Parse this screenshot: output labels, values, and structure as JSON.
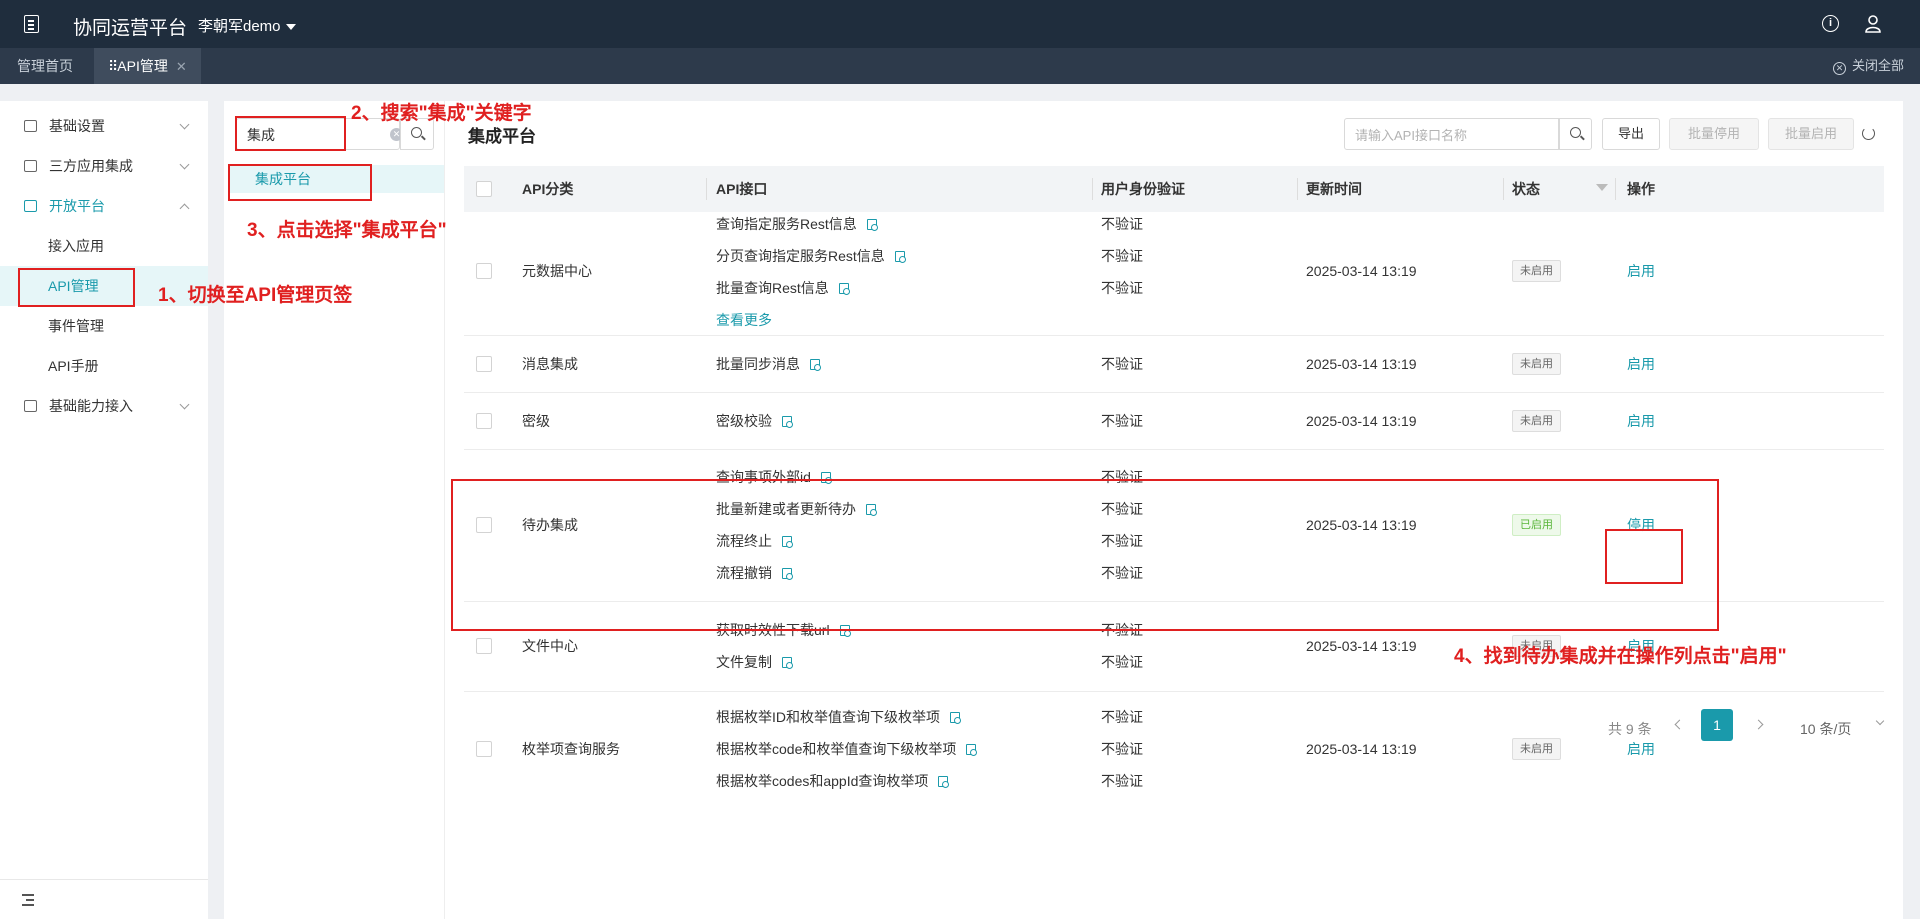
{
  "topbar": {
    "app_title": "协同运营平台",
    "user_name": "李朝军demo"
  },
  "tabs": [
    {
      "label": "管理首页"
    },
    {
      "label": "API管理"
    }
  ],
  "close_all": "关闭全部",
  "sidebar": {
    "groups": [
      {
        "label": "基础设置",
        "icon": "settings-icon"
      },
      {
        "label": "三方应用集成",
        "icon": "apps-icon"
      },
      {
        "label": "开放平台",
        "icon": "monitor-icon"
      },
      {
        "label": "基础能力接入",
        "icon": "capability-icon"
      }
    ],
    "items": [
      {
        "label": "接入应用"
      },
      {
        "label": "API管理"
      },
      {
        "label": "事件管理"
      },
      {
        "label": "API手册"
      }
    ]
  },
  "category_panel": {
    "search_value": "集成",
    "selected_item": "集成平台"
  },
  "main": {
    "title": "集成平台",
    "search_placeholder": "请输入API接口名称",
    "export_label": "导出",
    "batch_disable_label": "批量停用",
    "batch_enable_label": "批量启用",
    "columns": [
      "API分类",
      "API接口",
      "用户身份验证",
      "更新时间",
      "状态",
      "操作"
    ],
    "see_more": "查看更多",
    "rows": [
      {
        "category": "元数据中心",
        "apis": [
          "查询指定服务Rest信息",
          "分页查询指定服务Rest信息",
          "批量查询Rest信息"
        ],
        "auth": [
          "不验证",
          "不验证",
          "不验证"
        ],
        "time": "2025-03-14 13:19",
        "status": "未启用",
        "action": "启用"
      },
      {
        "category": "消息集成",
        "apis": [
          "批量同步消息"
        ],
        "auth": [
          "不验证"
        ],
        "time": "2025-03-14 13:19",
        "status": "未启用",
        "action": "启用"
      },
      {
        "category": "密级",
        "apis": [
          "密级校验"
        ],
        "auth": [
          "不验证"
        ],
        "time": "2025-03-14 13:19",
        "status": "未启用",
        "action": "启用"
      },
      {
        "category": "待办集成",
        "apis": [
          "查询事项外部id",
          "批量新建或者更新待办",
          "流程终止",
          "流程撤销"
        ],
        "auth": [
          "不验证",
          "不验证",
          "不验证",
          "不验证"
        ],
        "time": "2025-03-14 13:19",
        "status": "已启用",
        "action": "停用"
      },
      {
        "category": "文件中心",
        "apis": [
          "获取时效性下载url",
          "文件复制"
        ],
        "auth": [
          "不验证",
          "不验证"
        ],
        "time": "2025-03-14 13:19",
        "status": "未启用",
        "action": "启用"
      },
      {
        "category": "枚举项查询服务",
        "apis": [
          "根据枚举ID和枚举值查询下级枚举项",
          "根据枚举code和枚举值查询下级枚举项",
          "根据枚举codes和appId查询枚举项"
        ],
        "auth": [
          "不验证",
          "不验证",
          "不验证"
        ],
        "time": "2025-03-14 13:19",
        "status": "未启用",
        "action": "启用"
      }
    ]
  },
  "pagination": {
    "total": "共 9 条",
    "current_page": "1",
    "page_size": "10 条/页"
  },
  "annotations": {
    "step1": "1、切换至API管理页签",
    "step2": "2、搜索\"集成\"关键字",
    "step3": "3、点击选择\"集成平台\"",
    "step4": "4、找到待办集成并在操作列点击\"启用\""
  },
  "colors": {
    "accent": "#1a9aab",
    "topbar": "#1f2d3d",
    "annotation": "#e02020"
  }
}
